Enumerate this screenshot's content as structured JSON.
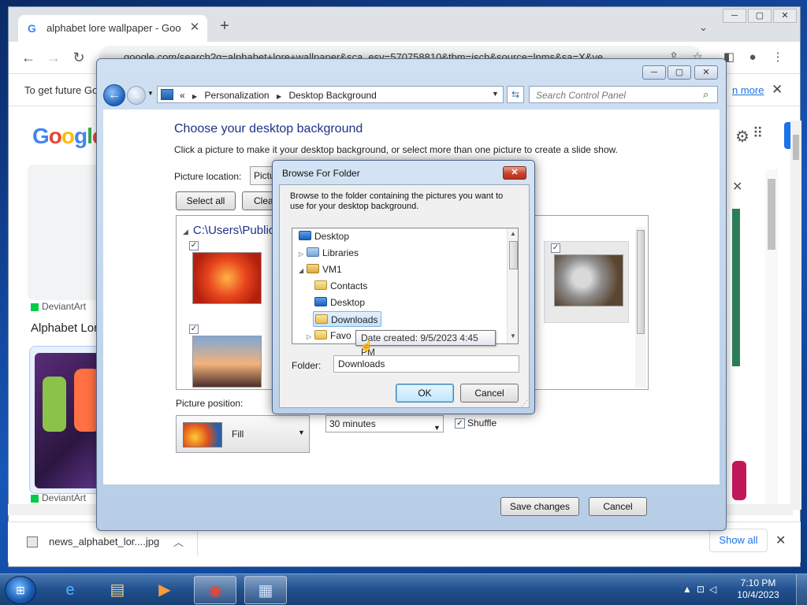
{
  "chrome": {
    "tab_title": "alphabet lore wallpaper - Google",
    "tab_close": "✕",
    "new_tab": "+",
    "url": "google.com/search?q=alphabet+lore+wallpaper&sca_esv=570758810&tbm=isch&source=lnms&sa=X&ve",
    "infobar_message": "To get future Go",
    "infobar_link": "n more",
    "window_controls": [
      "─",
      "▢",
      "✕"
    ]
  },
  "google": {
    "logo": [
      "G",
      "o",
      "o",
      "g",
      "l",
      "e"
    ],
    "results": [
      {
        "source": "DeviantArt",
        "title": "Alphabet Lore"
      },
      {
        "source": "DeviantArt"
      }
    ]
  },
  "downloads": {
    "file_name": "news_alphabet_lor....jpg",
    "show_all": "Show all"
  },
  "control_panel": {
    "breadcrumbs": [
      "Personalization",
      "Desktop Background"
    ],
    "breadcrumb_prefix": "«",
    "search_placeholder": "Search Control Panel",
    "heading": "Choose your desktop background",
    "subtext": "Click a picture to make it your desktop background, or select more than one picture to create a slide show.",
    "picture_location_label": "Picture location:",
    "picture_location_value": "Pictu",
    "select_all": "Select all",
    "clear": "Clea",
    "gallery_path": "C:\\Users\\Public\\",
    "picture_position_label": "Picture position:",
    "picture_position_value": "Fill",
    "interval_value": "30 minutes",
    "shuffle_label": "Shuffle",
    "save_changes": "Save changes",
    "cancel": "Cancel"
  },
  "browse_dialog": {
    "title": "Browse For Folder",
    "message": "Browse to the folder containing the pictures you want to use for your desktop background.",
    "tree": [
      {
        "label": "Desktop",
        "level": 0,
        "icon": "desktop-folder-icon"
      },
      {
        "label": "Libraries",
        "level": 1,
        "icon": "libraries-icon"
      },
      {
        "label": "VM1",
        "level": 1,
        "icon": "user-folder-icon"
      },
      {
        "label": "Contacts",
        "level": 2,
        "icon": "contacts-folder-icon"
      },
      {
        "label": "Desktop",
        "level": 2,
        "icon": "desktop-folder-icon"
      },
      {
        "label": "Downloads",
        "level": 2,
        "icon": "downloads-folder-icon",
        "selected": true
      },
      {
        "label": "Favo",
        "level": 2,
        "icon": "favorites-folder-icon"
      }
    ],
    "tooltip": "Date created: 9/5/2023 4:45 PM",
    "folder_label": "Folder:",
    "folder_value": "Downloads",
    "ok": "OK",
    "cancel": "Cancel"
  },
  "taskbar": {
    "time": "7:10 PM",
    "date": "10/4/2023",
    "apps": [
      "internet-explorer-icon",
      "file-explorer-icon",
      "media-player-icon",
      "chrome-icon",
      "control-panel-icon"
    ]
  },
  "colors": {
    "cp_heading": "#1e3287",
    "link": "#1a73e8",
    "taskbar": "#21508e"
  }
}
